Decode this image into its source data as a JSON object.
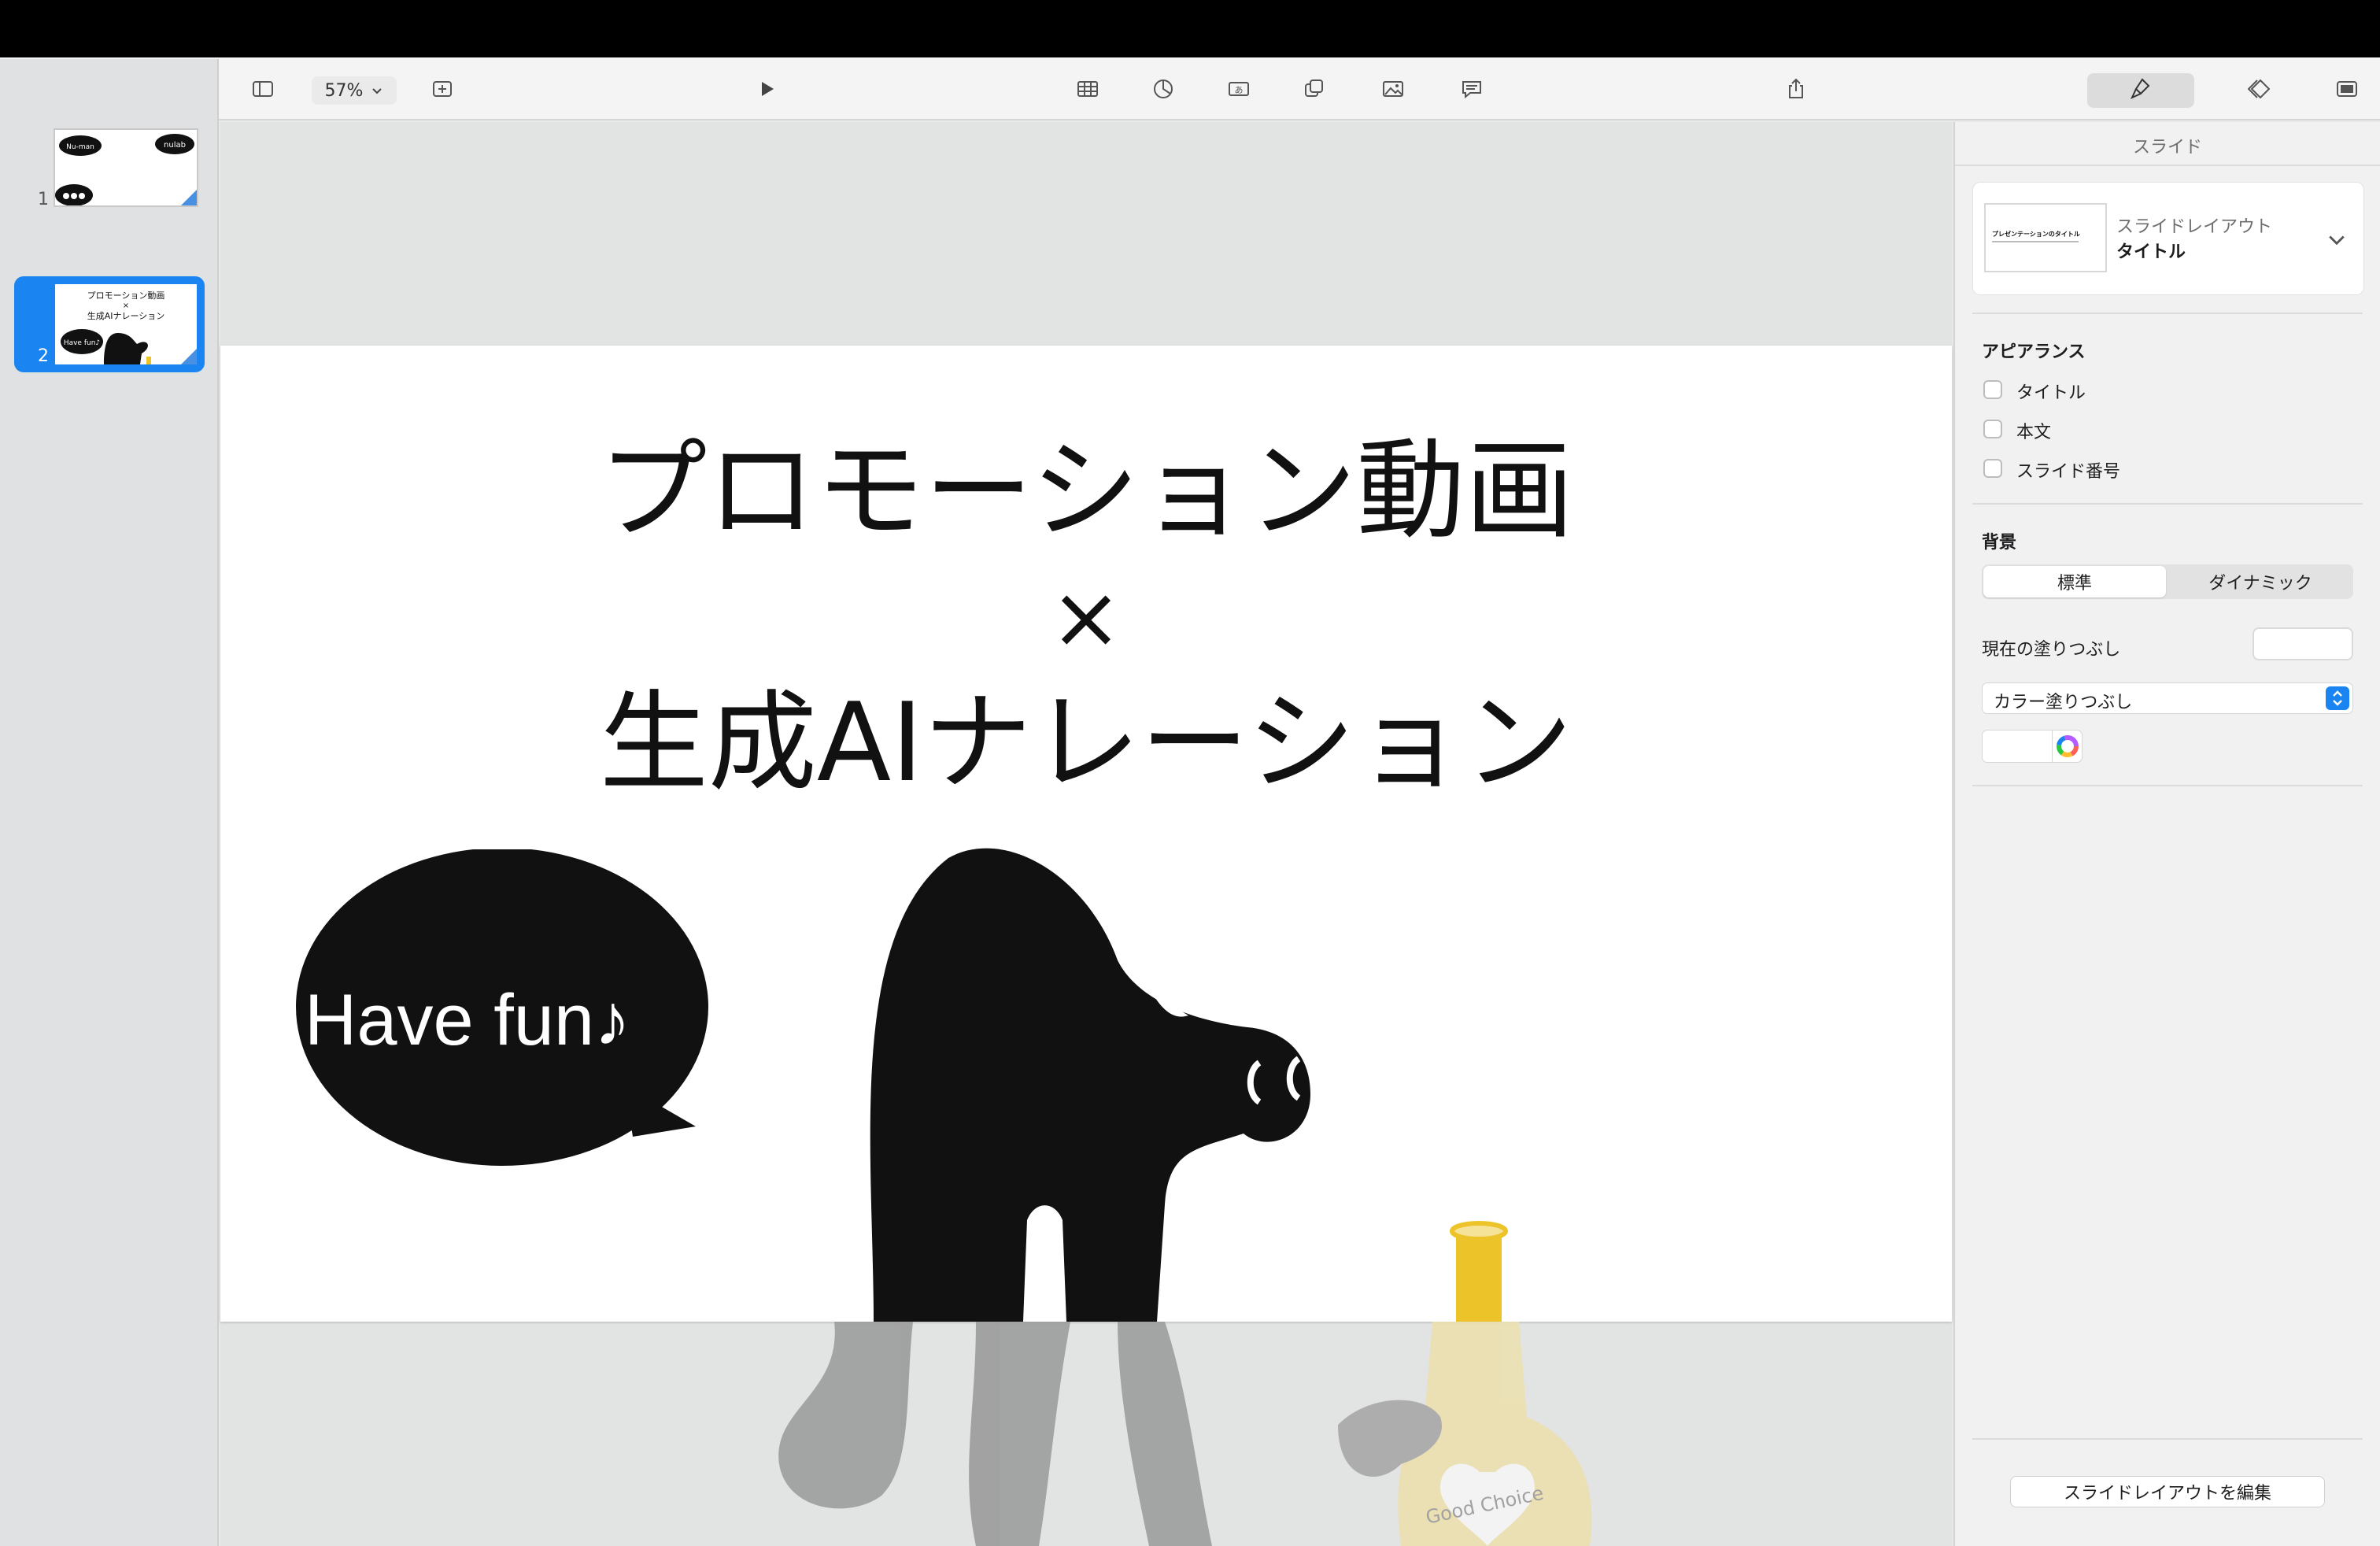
{
  "toolbar": {
    "zoom_label": "57%",
    "icons": [
      "sidebar-icon",
      "chevron-down-icon",
      "add-slide-icon",
      "play-icon",
      "table-icon",
      "chart-icon",
      "text-icon",
      "shape-icon",
      "media-icon",
      "comment-icon",
      "share-icon",
      "format-icon",
      "animate-icon",
      "document-icon"
    ]
  },
  "navigator": {
    "slides": [
      {
        "number": "1",
        "bubbles": [
          "Nu-man",
          "nulab"
        ]
      },
      {
        "number": "2",
        "title_lines": [
          "プロモーション動画",
          "×",
          "生成AIナレーション"
        ],
        "bubble": "Have fun♪"
      }
    ]
  },
  "slide": {
    "title_line1": "プロモーション動画",
    "title_line2": "×",
    "title_line3": "生成AIナレーション",
    "bubble_text": "Have fun♪",
    "bottle_label": "Good Choice"
  },
  "inspector": {
    "tab_title": "スライド",
    "layout_caption": "スライドレイアウト",
    "layout_name": "タイトル",
    "layout_thumb_text": "プレゼンテーションのタイトル",
    "appearance_header": "アピアランス",
    "appearance_options": [
      "タイトル",
      "本文",
      "スライド番号"
    ],
    "background_header": "背景",
    "segment_standard": "標準",
    "segment_dynamic": "ダイナミック",
    "current_fill_label": "現在の塗りつぶし",
    "fill_type": "カラー塗りつぶし",
    "edit_layout_button": "スライドレイアウトを編集"
  },
  "colors": {
    "accent": "#1a84f0",
    "bottle_yellow": "#ecc42a",
    "character": "#111111"
  }
}
